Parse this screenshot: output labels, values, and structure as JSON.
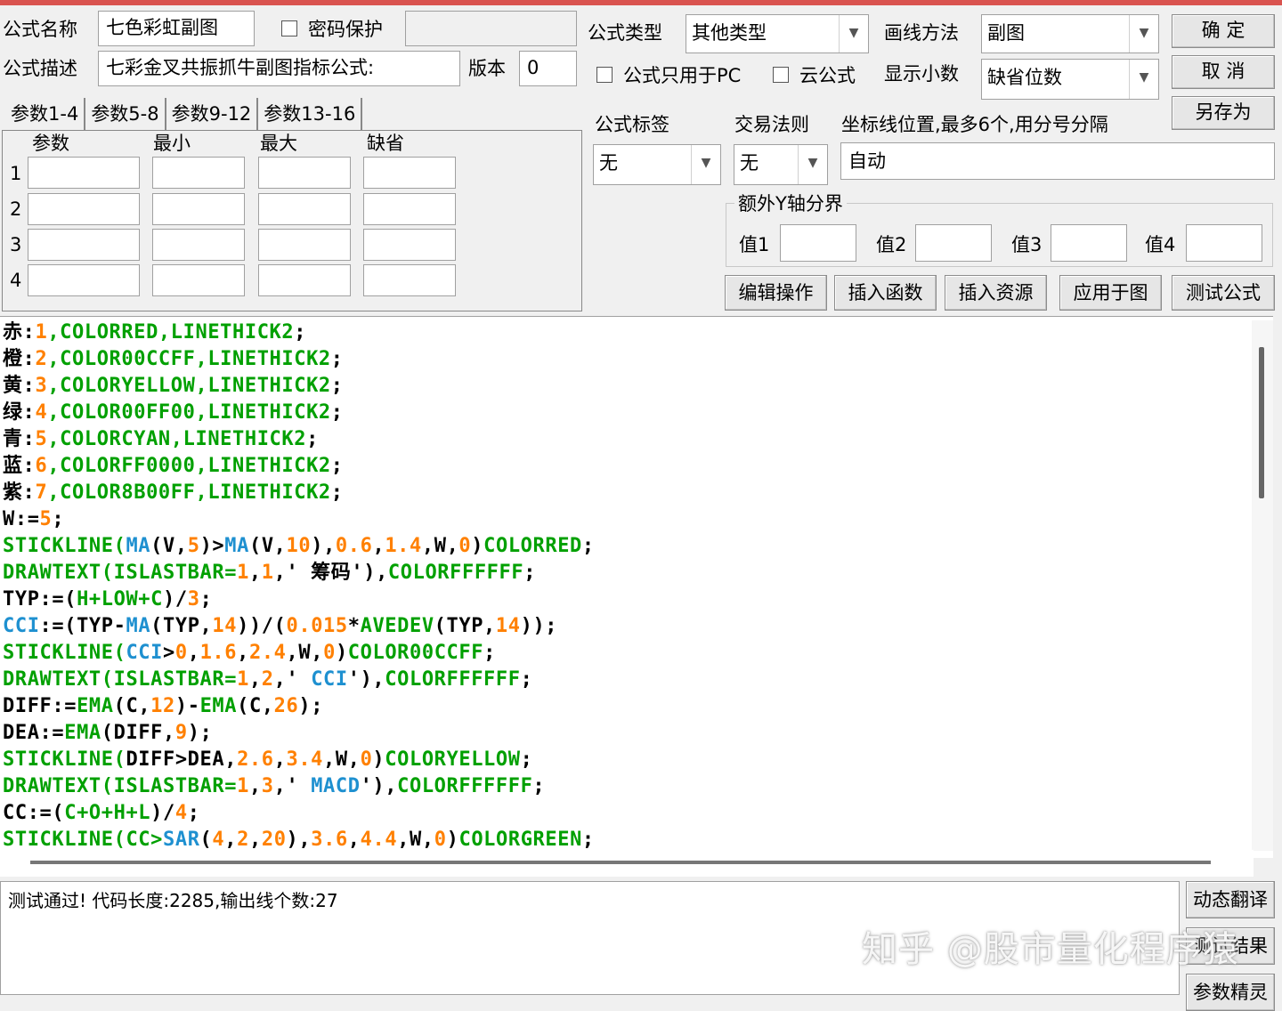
{
  "header": {
    "formula_name_label": "公式名称",
    "formula_name_value": "七色彩虹副图",
    "password_label": "密码保护",
    "password_value": "",
    "formula_desc_label": "公式描述",
    "formula_desc_value": "七彩金叉共振抓牛副图指标公式:",
    "version_label": "版本",
    "version_value": "0",
    "formula_type_label": "公式类型",
    "formula_type_value": "其他类型",
    "draw_method_label": "画线方法",
    "draw_method_value": "副图",
    "pc_only_label": "公式只用于PC",
    "cloud_label": "云公式",
    "decimals_label": "显示小数",
    "decimals_value": "缺省位数"
  },
  "buttons": {
    "ok": "确 定",
    "cancel": "取 消",
    "save_as": "另存为",
    "edit_ops": "编辑操作",
    "insert_func": "插入函数",
    "insert_res": "插入资源",
    "apply_chart": "应用于图",
    "test_formula": "测试公式",
    "dynamic_translate": "动态翻译",
    "test_result": "测试结果",
    "param_wizard": "参数精灵"
  },
  "params": {
    "tabs": [
      "参数1-4",
      "参数5-8",
      "参数9-12",
      "参数13-16"
    ],
    "columns": [
      "参数",
      "最小",
      "最大",
      "缺省"
    ],
    "rows": [
      "1",
      "2",
      "3",
      "4"
    ]
  },
  "right_panel": {
    "formula_tag_label": "公式标签",
    "formula_tag_value": "无",
    "trade_rule_label": "交易法则",
    "trade_rule_value": "无",
    "axis_label": "坐标线位置,最多6个,用分号分隔",
    "axis_value": "自动",
    "extra_y_label": "额外Y轴分界",
    "v1_label": "值1",
    "v2_label": "值2",
    "v3_label": "值3",
    "v4_label": "值4"
  },
  "code": [
    [
      [
        "赤",
        "#000"
      ],
      [
        ":",
        "#000"
      ],
      [
        "1",
        "#ff8000"
      ],
      [
        ",COLORRED,LINETHICK2",
        "#00a000"
      ],
      [
        ";",
        "#000"
      ]
    ],
    [
      [
        "橙",
        "#000"
      ],
      [
        ":",
        "#000"
      ],
      [
        "2",
        "#ff8000"
      ],
      [
        ",COLOR00CCFF,LINETHICK2",
        "#00a000"
      ],
      [
        ";",
        "#000"
      ]
    ],
    [
      [
        "黄",
        "#000"
      ],
      [
        ":",
        "#000"
      ],
      [
        "3",
        "#ff8000"
      ],
      [
        ",COLORYELLOW,LINETHICK2",
        "#00a000"
      ],
      [
        ";",
        "#000"
      ]
    ],
    [
      [
        "绿",
        "#000"
      ],
      [
        ":",
        "#000"
      ],
      [
        "4",
        "#ff8000"
      ],
      [
        ",COLOR00FF00,LINETHICK2",
        "#00a000"
      ],
      [
        ";",
        "#000"
      ]
    ],
    [
      [
        "青",
        "#000"
      ],
      [
        ":",
        "#000"
      ],
      [
        "5",
        "#ff8000"
      ],
      [
        ",COLORCYAN,LINETHICK2",
        "#00a000"
      ],
      [
        ";",
        "#000"
      ]
    ],
    [
      [
        "蓝",
        "#000"
      ],
      [
        ":",
        "#000"
      ],
      [
        "6",
        "#ff8000"
      ],
      [
        ",COLORFF0000,LINETHICK2",
        "#00a000"
      ],
      [
        ";",
        "#000"
      ]
    ],
    [
      [
        "紫",
        "#000"
      ],
      [
        ":",
        "#000"
      ],
      [
        "7",
        "#ff8000"
      ],
      [
        ",COLOR8B00FF,LINETHICK2",
        "#00a000"
      ],
      [
        ";",
        "#000"
      ]
    ],
    [
      [
        "W:=",
        "#000"
      ],
      [
        "5",
        "#ff8000"
      ],
      [
        ";",
        "#000"
      ]
    ],
    [
      [
        "STICKLINE(",
        "#00a000"
      ],
      [
        "MA",
        "#1e90d0"
      ],
      [
        "(V,",
        "#000"
      ],
      [
        "5",
        "#ff8000"
      ],
      [
        ")>",
        "#000"
      ],
      [
        "MA",
        "#1e90d0"
      ],
      [
        "(V,",
        "#000"
      ],
      [
        "10",
        "#ff8000"
      ],
      [
        "),",
        "#000"
      ],
      [
        "0.6",
        "#ff8000"
      ],
      [
        ",",
        "#000"
      ],
      [
        "1.4",
        "#ff8000"
      ],
      [
        ",W,",
        "#000"
      ],
      [
        "0",
        "#ff8000"
      ],
      [
        ")",
        "#000"
      ],
      [
        "COLORRED",
        "#00a000"
      ],
      [
        ";",
        "#000"
      ]
    ],
    [
      [
        "DRAWTEXT(ISLASTBAR=",
        "#00a000"
      ],
      [
        "1",
        "#ff8000"
      ],
      [
        ",",
        "#000"
      ],
      [
        "1",
        "#ff8000"
      ],
      [
        ",' 筹码'),",
        "#000"
      ],
      [
        "COLORFFFFFF",
        "#00a000"
      ],
      [
        ";",
        "#000"
      ]
    ],
    [
      [
        "TYP:=(",
        "#000"
      ],
      [
        "H+LOW+C",
        "#00a000"
      ],
      [
        ")/",
        "#000"
      ],
      [
        "3",
        "#ff8000"
      ],
      [
        ";",
        "#000"
      ]
    ],
    [
      [
        "CCI",
        "#1e90d0"
      ],
      [
        ":=(TYP-",
        "#000"
      ],
      [
        "MA",
        "#1e90d0"
      ],
      [
        "(TYP,",
        "#000"
      ],
      [
        "14",
        "#ff8000"
      ],
      [
        "))/(",
        "#000"
      ],
      [
        "0.015",
        "#ff8000"
      ],
      [
        "*",
        "#000"
      ],
      [
        "AVEDEV",
        "#00a000"
      ],
      [
        "(TYP,",
        "#000"
      ],
      [
        "14",
        "#ff8000"
      ],
      [
        "));",
        "#000"
      ]
    ],
    [
      [
        "STICKLINE(",
        "#00a000"
      ],
      [
        "CCI",
        "#1e90d0"
      ],
      [
        ">",
        "#000"
      ],
      [
        "0",
        "#ff8000"
      ],
      [
        ",",
        "#000"
      ],
      [
        "1.6",
        "#ff8000"
      ],
      [
        ",",
        "#000"
      ],
      [
        "2.4",
        "#ff8000"
      ],
      [
        ",W,",
        "#000"
      ],
      [
        "0",
        "#ff8000"
      ],
      [
        ")",
        "#000"
      ],
      [
        "COLOR00CCFF",
        "#00a000"
      ],
      [
        ";",
        "#000"
      ]
    ],
    [
      [
        "DRAWTEXT(ISLASTBAR=",
        "#00a000"
      ],
      [
        "1",
        "#ff8000"
      ],
      [
        ",",
        "#000"
      ],
      [
        "2",
        "#ff8000"
      ],
      [
        ",' ",
        "#000"
      ],
      [
        "CCI",
        "#1e90d0"
      ],
      [
        "'),",
        "#000"
      ],
      [
        "COLORFFFFFF",
        "#00a000"
      ],
      [
        ";",
        "#000"
      ]
    ],
    [
      [
        "DIFF:=",
        "#000"
      ],
      [
        "EMA",
        "#00a000"
      ],
      [
        "(C,",
        "#000"
      ],
      [
        "12",
        "#ff8000"
      ],
      [
        ")-",
        "#000"
      ],
      [
        "EMA",
        "#00a000"
      ],
      [
        "(C,",
        "#000"
      ],
      [
        "26",
        "#ff8000"
      ],
      [
        ");",
        "#000"
      ]
    ],
    [
      [
        "DEA:=",
        "#000"
      ],
      [
        "EMA",
        "#00a000"
      ],
      [
        "(DIFF,",
        "#000"
      ],
      [
        "9",
        "#ff8000"
      ],
      [
        ");",
        "#000"
      ]
    ],
    [
      [
        "STICKLINE(",
        "#00a000"
      ],
      [
        "DIFF>DEA,",
        "#000"
      ],
      [
        "2.6",
        "#ff8000"
      ],
      [
        ",",
        "#000"
      ],
      [
        "3.4",
        "#ff8000"
      ],
      [
        ",W,",
        "#000"
      ],
      [
        "0",
        "#ff8000"
      ],
      [
        ")",
        "#000"
      ],
      [
        "COLORYELLOW",
        "#00a000"
      ],
      [
        ";",
        "#000"
      ]
    ],
    [
      [
        "DRAWTEXT(ISLASTBAR=",
        "#00a000"
      ],
      [
        "1",
        "#ff8000"
      ],
      [
        ",",
        "#000"
      ],
      [
        "3",
        "#ff8000"
      ],
      [
        ",' ",
        "#000"
      ],
      [
        "MACD",
        "#1e90d0"
      ],
      [
        "'),",
        "#000"
      ],
      [
        "COLORFFFFFF",
        "#00a000"
      ],
      [
        ";",
        "#000"
      ]
    ],
    [
      [
        "CC:=(",
        "#000"
      ],
      [
        "C+O+H+L",
        "#00a000"
      ],
      [
        ")/",
        "#000"
      ],
      [
        "4",
        "#ff8000"
      ],
      [
        ";",
        "#000"
      ]
    ],
    [
      [
        "STICKLINE(CC>",
        "#00a000"
      ],
      [
        "SAR",
        "#1e90d0"
      ],
      [
        "(",
        "#000"
      ],
      [
        "4",
        "#ff8000"
      ],
      [
        ",",
        "#000"
      ],
      [
        "2",
        "#ff8000"
      ],
      [
        ",",
        "#000"
      ],
      [
        "20",
        "#ff8000"
      ],
      [
        "),",
        "#000"
      ],
      [
        "3.6",
        "#ff8000"
      ],
      [
        ",",
        "#000"
      ],
      [
        "4.4",
        "#ff8000"
      ],
      [
        ",W,",
        "#000"
      ],
      [
        "0",
        "#ff8000"
      ],
      [
        ")",
        "#000"
      ],
      [
        "COLORGREEN",
        "#00a000"
      ],
      [
        ";",
        "#000"
      ]
    ]
  ],
  "output": {
    "message": "测试通过! 代码长度:2285,输出线个数:27"
  },
  "watermark": "知乎 @股市量化程序猿"
}
